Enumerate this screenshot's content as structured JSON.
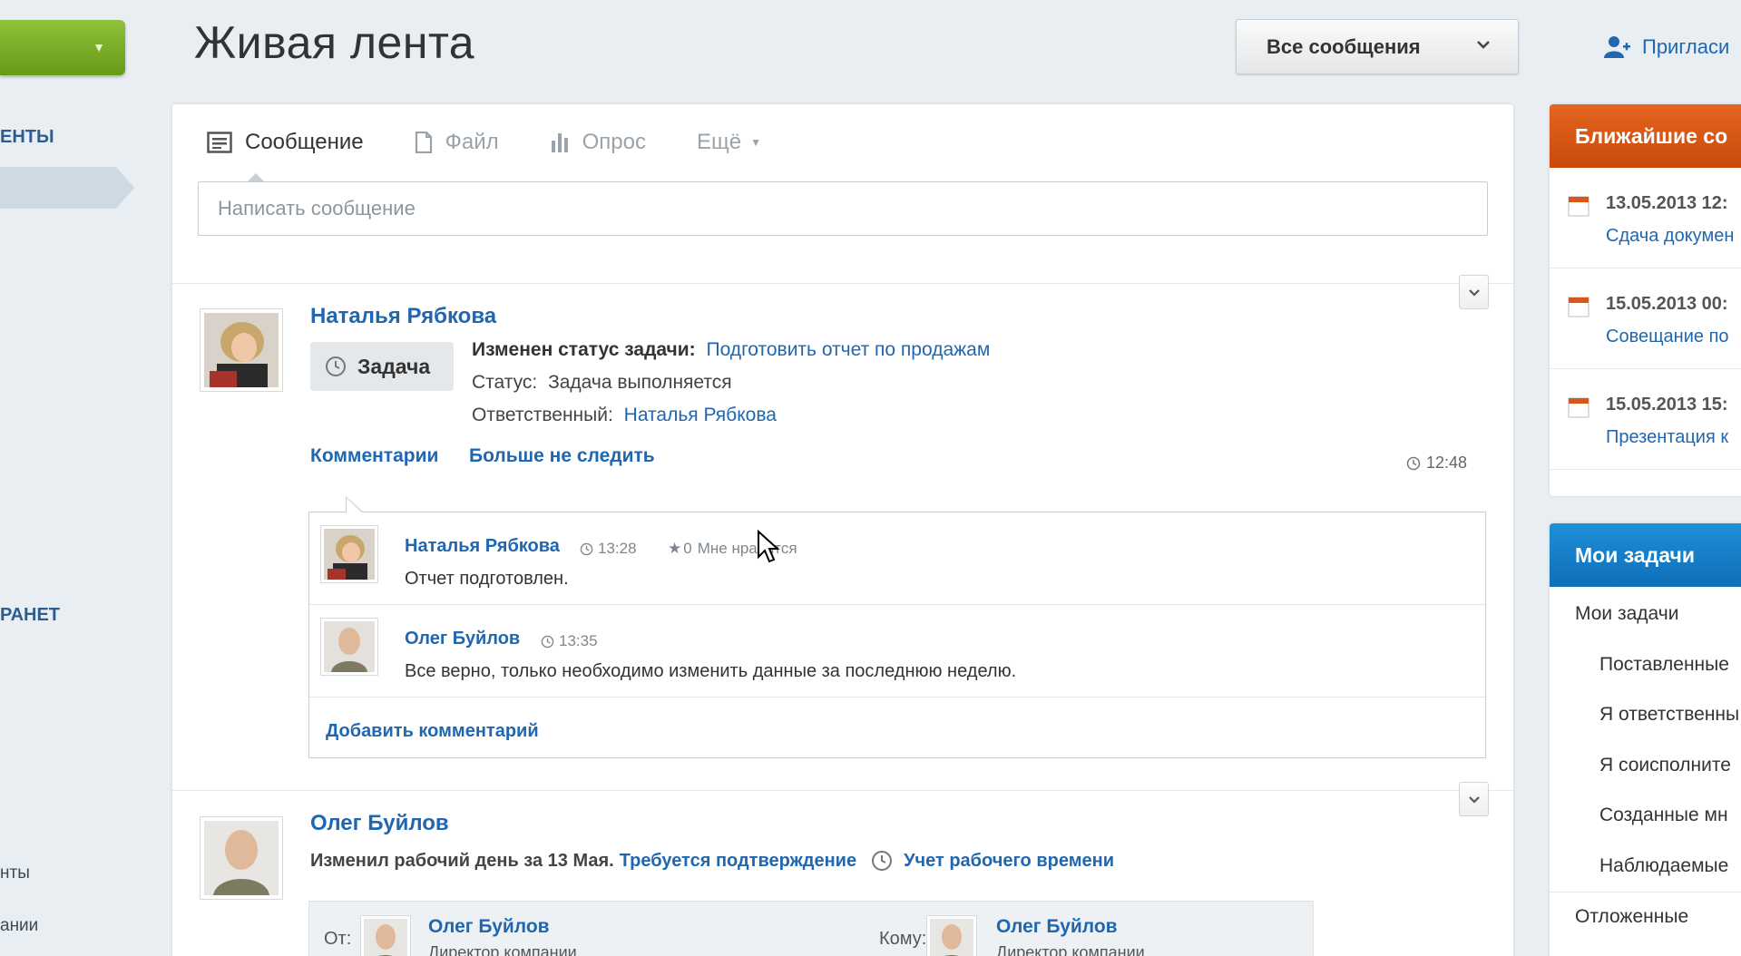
{
  "sidebar": {
    "item_1": "ЕНТЫ",
    "item_2": "РАНЕТ",
    "item_3": "нты",
    "item_4": "ании"
  },
  "header": {
    "title": "Живая лента",
    "filter_label": "Все сообщения",
    "invite_label": "Пригласи"
  },
  "composer": {
    "tabs": [
      {
        "label": "Сообщение",
        "icon": "message-icon"
      },
      {
        "label": "Файл",
        "icon": "file-icon"
      },
      {
        "label": "Опрос",
        "icon": "poll-icon"
      },
      {
        "label": "Ещё",
        "icon": "caret-down-icon"
      }
    ],
    "placeholder": "Написать сообщение"
  },
  "post1": {
    "author": "Наталья Рябкова",
    "badge": "Задача",
    "status_change_label": "Изменен статус задачи:",
    "task_link": "Подготовить отчет по продажам",
    "status_label": "Статус:",
    "status_value": "Задача выполняется",
    "responsible_label": "Ответственный:",
    "responsible_value": "Наталья Рябкова",
    "comments_link": "Комментарии",
    "unfollow_link": "Больше не следить",
    "time": "12:48",
    "comments": [
      {
        "author": "Наталья Рябкова",
        "time": "13:28",
        "likes": "0",
        "like_label": "Мне нравится",
        "text": "Отчет подготовлен."
      },
      {
        "author": "Олег Буйлов",
        "time": "13:35",
        "text": "Все верно, только необходимо изменить данные за последнюю неделю."
      }
    ],
    "add_comment": "Добавить комментарий"
  },
  "post2": {
    "author": "Олег Буйлов",
    "text": "Изменил рабочий день за 13 Мая.",
    "confirm_link": "Требуется подтверждение",
    "worktime_link": "Учет рабочего времени",
    "from_label": "От:",
    "from_name": "Олег Буйлов",
    "from_position": "Директор компании",
    "to_label": "Кому:",
    "to_name": "Олег Буйлов",
    "to_position": "Директор компании"
  },
  "events_widget": {
    "title": "Ближайшие со",
    "events": [
      {
        "date": "13.05.2013 12:",
        "title": "Сдача докумен"
      },
      {
        "date": "15.05.2013 00:",
        "title": "Совещание по"
      },
      {
        "date": "15.05.2013 15:",
        "title": "Презентация к"
      }
    ]
  },
  "tasks_widget": {
    "title": "Мои задачи",
    "items": [
      "Мои задачи",
      "Поставленные",
      "Я ответственны",
      "Я соисполните",
      "Созданные мн",
      "Наблюдаемые",
      "Отложенные"
    ]
  },
  "colors": {
    "accent_blue": "#2067b0",
    "events_orange": "#d9571a",
    "tasks_blue": "#1a84cf",
    "create_green": "#7cb02a"
  }
}
